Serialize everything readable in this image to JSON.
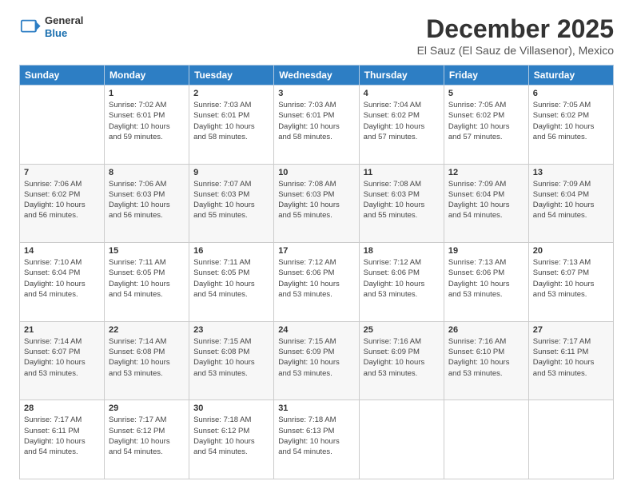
{
  "logo": {
    "general": "General",
    "blue": "Blue"
  },
  "header": {
    "month": "December 2025",
    "location": "El Sauz (El Sauz de Villasenor), Mexico"
  },
  "weekdays": [
    "Sunday",
    "Monday",
    "Tuesday",
    "Wednesday",
    "Thursday",
    "Friday",
    "Saturday"
  ],
  "weeks": [
    [
      {
        "day": "",
        "info": ""
      },
      {
        "day": "1",
        "info": "Sunrise: 7:02 AM\nSunset: 6:01 PM\nDaylight: 10 hours\nand 59 minutes."
      },
      {
        "day": "2",
        "info": "Sunrise: 7:03 AM\nSunset: 6:01 PM\nDaylight: 10 hours\nand 58 minutes."
      },
      {
        "day": "3",
        "info": "Sunrise: 7:03 AM\nSunset: 6:01 PM\nDaylight: 10 hours\nand 58 minutes."
      },
      {
        "day": "4",
        "info": "Sunrise: 7:04 AM\nSunset: 6:02 PM\nDaylight: 10 hours\nand 57 minutes."
      },
      {
        "day": "5",
        "info": "Sunrise: 7:05 AM\nSunset: 6:02 PM\nDaylight: 10 hours\nand 57 minutes."
      },
      {
        "day": "6",
        "info": "Sunrise: 7:05 AM\nSunset: 6:02 PM\nDaylight: 10 hours\nand 56 minutes."
      }
    ],
    [
      {
        "day": "7",
        "info": "Sunrise: 7:06 AM\nSunset: 6:02 PM\nDaylight: 10 hours\nand 56 minutes."
      },
      {
        "day": "8",
        "info": "Sunrise: 7:06 AM\nSunset: 6:03 PM\nDaylight: 10 hours\nand 56 minutes."
      },
      {
        "day": "9",
        "info": "Sunrise: 7:07 AM\nSunset: 6:03 PM\nDaylight: 10 hours\nand 55 minutes."
      },
      {
        "day": "10",
        "info": "Sunrise: 7:08 AM\nSunset: 6:03 PM\nDaylight: 10 hours\nand 55 minutes."
      },
      {
        "day": "11",
        "info": "Sunrise: 7:08 AM\nSunset: 6:03 PM\nDaylight: 10 hours\nand 55 minutes."
      },
      {
        "day": "12",
        "info": "Sunrise: 7:09 AM\nSunset: 6:04 PM\nDaylight: 10 hours\nand 54 minutes."
      },
      {
        "day": "13",
        "info": "Sunrise: 7:09 AM\nSunset: 6:04 PM\nDaylight: 10 hours\nand 54 minutes."
      }
    ],
    [
      {
        "day": "14",
        "info": "Sunrise: 7:10 AM\nSunset: 6:04 PM\nDaylight: 10 hours\nand 54 minutes."
      },
      {
        "day": "15",
        "info": "Sunrise: 7:11 AM\nSunset: 6:05 PM\nDaylight: 10 hours\nand 54 minutes."
      },
      {
        "day": "16",
        "info": "Sunrise: 7:11 AM\nSunset: 6:05 PM\nDaylight: 10 hours\nand 54 minutes."
      },
      {
        "day": "17",
        "info": "Sunrise: 7:12 AM\nSunset: 6:06 PM\nDaylight: 10 hours\nand 53 minutes."
      },
      {
        "day": "18",
        "info": "Sunrise: 7:12 AM\nSunset: 6:06 PM\nDaylight: 10 hours\nand 53 minutes."
      },
      {
        "day": "19",
        "info": "Sunrise: 7:13 AM\nSunset: 6:06 PM\nDaylight: 10 hours\nand 53 minutes."
      },
      {
        "day": "20",
        "info": "Sunrise: 7:13 AM\nSunset: 6:07 PM\nDaylight: 10 hours\nand 53 minutes."
      }
    ],
    [
      {
        "day": "21",
        "info": "Sunrise: 7:14 AM\nSunset: 6:07 PM\nDaylight: 10 hours\nand 53 minutes."
      },
      {
        "day": "22",
        "info": "Sunrise: 7:14 AM\nSunset: 6:08 PM\nDaylight: 10 hours\nand 53 minutes."
      },
      {
        "day": "23",
        "info": "Sunrise: 7:15 AM\nSunset: 6:08 PM\nDaylight: 10 hours\nand 53 minutes."
      },
      {
        "day": "24",
        "info": "Sunrise: 7:15 AM\nSunset: 6:09 PM\nDaylight: 10 hours\nand 53 minutes."
      },
      {
        "day": "25",
        "info": "Sunrise: 7:16 AM\nSunset: 6:09 PM\nDaylight: 10 hours\nand 53 minutes."
      },
      {
        "day": "26",
        "info": "Sunrise: 7:16 AM\nSunset: 6:10 PM\nDaylight: 10 hours\nand 53 minutes."
      },
      {
        "day": "27",
        "info": "Sunrise: 7:17 AM\nSunset: 6:11 PM\nDaylight: 10 hours\nand 53 minutes."
      }
    ],
    [
      {
        "day": "28",
        "info": "Sunrise: 7:17 AM\nSunset: 6:11 PM\nDaylight: 10 hours\nand 54 minutes."
      },
      {
        "day": "29",
        "info": "Sunrise: 7:17 AM\nSunset: 6:12 PM\nDaylight: 10 hours\nand 54 minutes."
      },
      {
        "day": "30",
        "info": "Sunrise: 7:18 AM\nSunset: 6:12 PM\nDaylight: 10 hours\nand 54 minutes."
      },
      {
        "day": "31",
        "info": "Sunrise: 7:18 AM\nSunset: 6:13 PM\nDaylight: 10 hours\nand 54 minutes."
      },
      {
        "day": "",
        "info": ""
      },
      {
        "day": "",
        "info": ""
      },
      {
        "day": "",
        "info": ""
      }
    ]
  ]
}
